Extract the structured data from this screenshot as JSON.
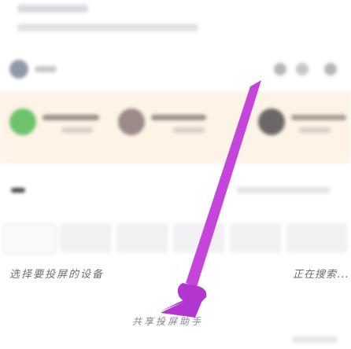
{
  "status": {
    "left_text": "选择要投屏的设备",
    "right_text": "正在搜索..."
  },
  "share_button": {
    "label": "共享投屏助手"
  },
  "annotation": {
    "arrow_color": "#c23ad8",
    "arrow_label_icon": "swipe-arrow-icon"
  },
  "colors": {
    "card_bg": "#fdf3e6",
    "accent_purple": "#c23ad8"
  }
}
